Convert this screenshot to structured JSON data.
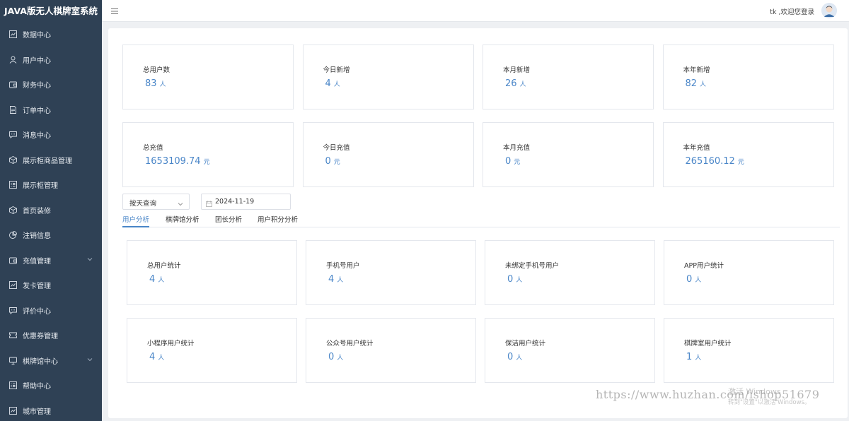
{
  "app": {
    "title": "JAVA版无人棋牌室系统"
  },
  "sidebar": {
    "items": [
      {
        "label": "数据中心",
        "icon": "chart-icon"
      },
      {
        "label": "用户中心",
        "icon": "user-icon"
      },
      {
        "label": "财务中心",
        "icon": "wallet-icon"
      },
      {
        "label": "订单中心",
        "icon": "document-icon"
      },
      {
        "label": "消息中心",
        "icon": "message-icon"
      },
      {
        "label": "展示柜商品管理",
        "icon": "box-icon"
      },
      {
        "label": "展示柜管理",
        "icon": "list-icon"
      },
      {
        "label": "首页装修",
        "icon": "box-icon"
      },
      {
        "label": "注销信息",
        "icon": "pie-icon"
      },
      {
        "label": "充值管理",
        "icon": "wallet-icon",
        "expandable": true
      },
      {
        "label": "发卡管理",
        "icon": "chart-icon"
      },
      {
        "label": "评价中心",
        "icon": "message-icon"
      },
      {
        "label": "优惠券管理",
        "icon": "coupon-icon"
      },
      {
        "label": "棋牌馆中心",
        "icon": "monitor-icon",
        "expandable": true
      },
      {
        "label": "帮助中心",
        "icon": "list-icon"
      },
      {
        "label": "城市管理",
        "icon": "chart-icon"
      }
    ]
  },
  "header": {
    "welcome": "tk ,欢迎您登录"
  },
  "summary": {
    "row1": [
      {
        "label": "总用户数",
        "value": "83",
        "unit": "人"
      },
      {
        "label": "今日新增",
        "value": "4",
        "unit": "人"
      },
      {
        "label": "本月新增",
        "value": "26",
        "unit": "人"
      },
      {
        "label": "本年新增",
        "value": "82",
        "unit": "人"
      }
    ],
    "row2": [
      {
        "label": "总充值",
        "value": "1653109.74",
        "unit": "元"
      },
      {
        "label": "今日充值",
        "value": "0",
        "unit": "元"
      },
      {
        "label": "本月充值",
        "value": "0",
        "unit": "元"
      },
      {
        "label": "本年充值",
        "value": "265160.12",
        "unit": "元"
      }
    ]
  },
  "filters": {
    "query_mode": "按天查询",
    "date": "2024-11-19"
  },
  "tabs": [
    {
      "label": "用户分析",
      "active": true
    },
    {
      "label": "棋牌馆分析"
    },
    {
      "label": "团长分析"
    },
    {
      "label": "用户积分分析"
    }
  ],
  "analysis": {
    "row1": [
      {
        "label": "总用户统计",
        "value": "4",
        "unit": "人"
      },
      {
        "label": "手机号用户",
        "value": "4",
        "unit": "人"
      },
      {
        "label": "未绑定手机号用户",
        "value": "0",
        "unit": "人"
      },
      {
        "label": "APP用户统计",
        "value": "0",
        "unit": "人"
      }
    ],
    "row2": [
      {
        "label": "小程序用户统计",
        "value": "4",
        "unit": "人"
      },
      {
        "label": "公众号用户统计",
        "value": "0",
        "unit": "人"
      },
      {
        "label": "保洁用户统计",
        "value": "0",
        "unit": "人"
      },
      {
        "label": "棋牌室用户统计",
        "value": "1",
        "unit": "人"
      }
    ]
  },
  "overlay": {
    "watermark": "https://www.huzhan.com/ishop51679",
    "windows_activate": "激活 Windows",
    "windows_hint": "转到\"设置\"以激活 Windows。"
  },
  "colors": {
    "sidebar": "#2f4155",
    "accent": "#4a86c8"
  }
}
